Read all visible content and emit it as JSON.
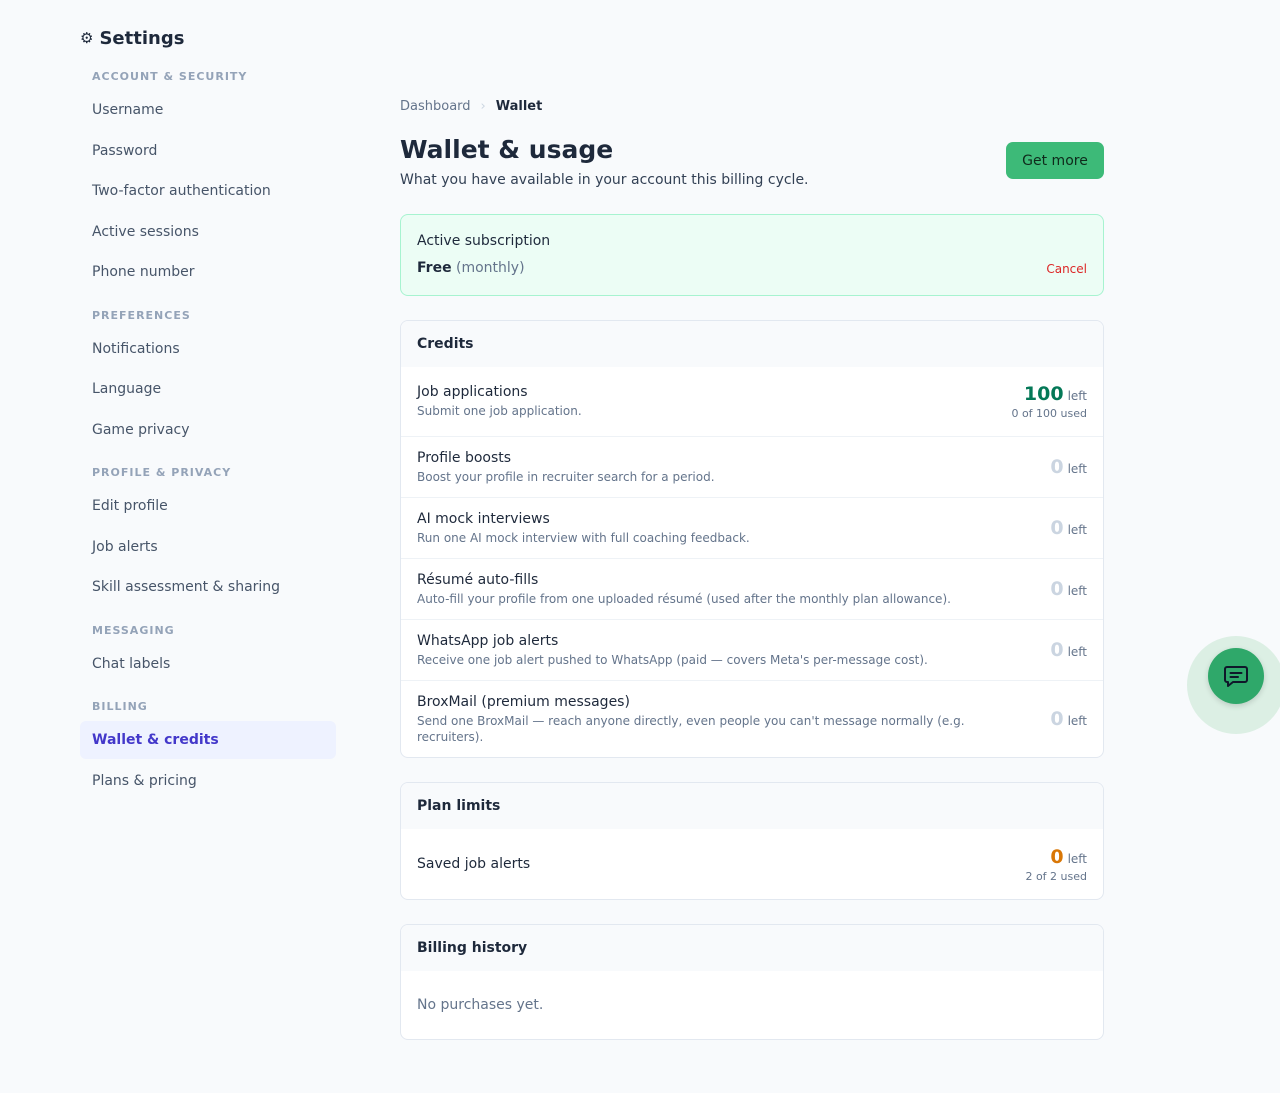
{
  "sidebar": {
    "title": "Settings",
    "gear_icon": "⚙",
    "sections": [
      {
        "label": "ACCOUNT & SECURITY",
        "items": [
          "Username",
          "Password",
          "Two-factor authentication",
          "Active sessions",
          "Phone number"
        ]
      },
      {
        "label": "PREFERENCES",
        "items": [
          "Notifications",
          "Language",
          "Game privacy"
        ]
      },
      {
        "label": "PROFILE & PRIVACY",
        "items": [
          "Edit profile",
          "Job alerts",
          "Skill assessment & sharing"
        ]
      },
      {
        "label": "MESSAGING",
        "items": [
          "Chat labels"
        ]
      },
      {
        "label": "BILLING",
        "items": [
          "Wallet & credits",
          "Plans & pricing"
        ]
      }
    ],
    "active_item": "Wallet & credits"
  },
  "breadcrumb": {
    "parent": "Dashboard",
    "separator": "›",
    "current": "Wallet"
  },
  "header": {
    "title": "Wallet & usage",
    "subtitle": "What you have available in your account this billing cycle.",
    "get_more_label": "Get more"
  },
  "subscription": {
    "label": "Active subscription",
    "plan": "Free",
    "period": "(monthly)",
    "cancel_label": "Cancel"
  },
  "credits": {
    "title": "Credits",
    "unit": "left",
    "items": [
      {
        "name": "Job applications",
        "desc": "Submit one job application.",
        "left": "100",
        "used": "0 of 100 used",
        "tone": "green"
      },
      {
        "name": "Profile boosts",
        "desc": "Boost your profile in recruiter search for a period.",
        "left": "0",
        "used": "",
        "tone": "gray"
      },
      {
        "name": "AI mock interviews",
        "desc": "Run one AI mock interview with full coaching feedback.",
        "left": "0",
        "used": "",
        "tone": "gray"
      },
      {
        "name": "Résumé auto-fills",
        "desc": "Auto-fill your profile from one uploaded résumé (used after the monthly plan allowance).",
        "left": "0",
        "used": "",
        "tone": "gray"
      },
      {
        "name": "WhatsApp job alerts",
        "desc": "Receive one job alert pushed to WhatsApp (paid — covers Meta's per-message cost).",
        "left": "0",
        "used": "",
        "tone": "gray"
      },
      {
        "name": "BroxMail (premium messages)",
        "desc": "Send one BroxMail — reach anyone directly, even people you can't message normally (e.g. recruiters).",
        "left": "0",
        "used": "",
        "tone": "gray"
      }
    ]
  },
  "plan_limits": {
    "title": "Plan limits",
    "unit": "left",
    "items": [
      {
        "name": "Saved job alerts",
        "desc": "",
        "left": "0",
        "used": "2 of 2 used",
        "tone": "orange"
      }
    ]
  },
  "billing_history": {
    "title": "Billing history",
    "empty_text": "No purchases yet."
  },
  "chat_fab": {
    "icon": "chat-bubble-icon"
  },
  "colors": {
    "accent": "#3dba78",
    "active_nav": "#4338ca",
    "danger": "#dc2626"
  }
}
